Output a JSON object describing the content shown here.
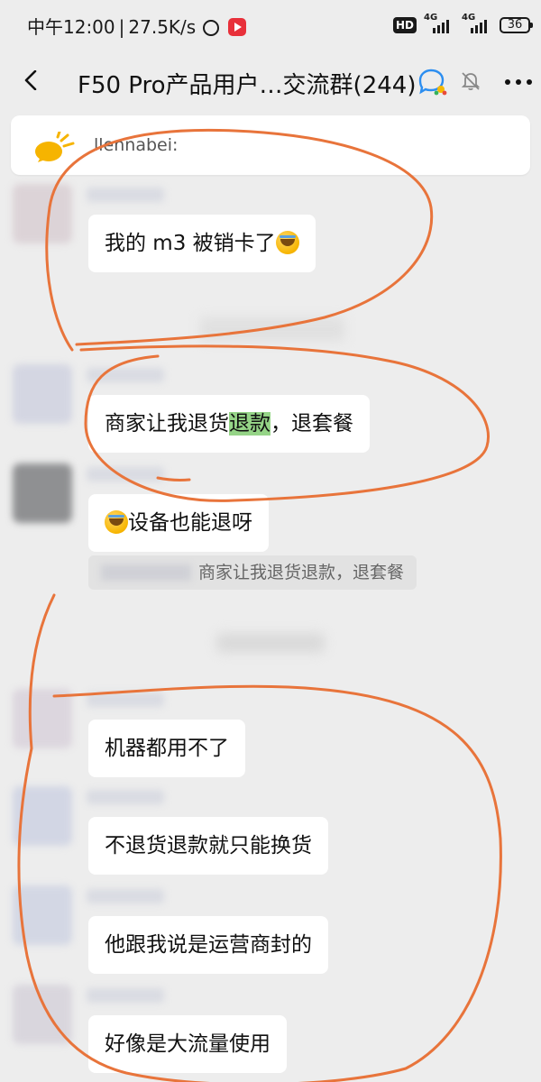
{
  "status_bar": {
    "time": "中午12:00",
    "net_speed": "27.5K/s",
    "hd_label": "HD",
    "sim1_network": "4G",
    "sim2_network": "4G",
    "battery": "36"
  },
  "title_bar": {
    "title": "F50 Pro产品用户…交流群(244)"
  },
  "notice": {
    "text": "llennabei:"
  },
  "messages": [
    {
      "text_before": "我的 m3 被销卡了",
      "has_emoji_after": true
    },
    {
      "text_before": "商家让我退货",
      "highlight": "退款",
      "text_after": "，退套餐"
    },
    {
      "text_after_emoji": "设备也能退呀",
      "has_emoji_before": true
    },
    {
      "text": "机器都用不了"
    },
    {
      "text": "不退货退款就只能换货"
    },
    {
      "text": "他跟我说是运营商封的"
    },
    {
      "text": "好像是大流量使用"
    }
  ],
  "quote": {
    "text": "商家让我退货退款，退套餐"
  },
  "colors": {
    "background": "#ededed",
    "bubble": "#ffffff",
    "highlight": "#95d487",
    "annotation": "#e8743b"
  }
}
